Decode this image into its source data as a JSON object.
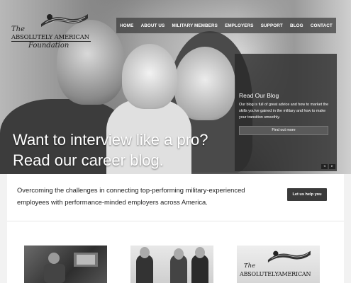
{
  "logo": {
    "the": "The",
    "name": "ABSOLUTELY AMERICAN",
    "subtitle": "Foundation"
  },
  "nav": {
    "items": [
      "HOME",
      "ABOUT US",
      "MILITARY MEMBERS",
      "EMPLOYERS",
      "SUPPORT",
      "BLOG",
      "CONTACT"
    ]
  },
  "hero": {
    "line1": "Want to interview like a pro?",
    "line2": "Read our career blog."
  },
  "blog_panel": {
    "title": "Read Our Blog",
    "description": "Our blog is full of great advice and how to market the skills you've gained in the military and how to make your transition smoothly.",
    "button": "Find out more"
  },
  "slider": {
    "prev": "◂",
    "next": "▸"
  },
  "callout": {
    "text": "Overcoming the challenges in connecting top-performing military-experienced employees with performance-minded employers across America.",
    "button": "Let us help you"
  },
  "thumbnails": {
    "third": {
      "the": "The",
      "name": "ABSOLUTELYAMERICAN"
    }
  }
}
